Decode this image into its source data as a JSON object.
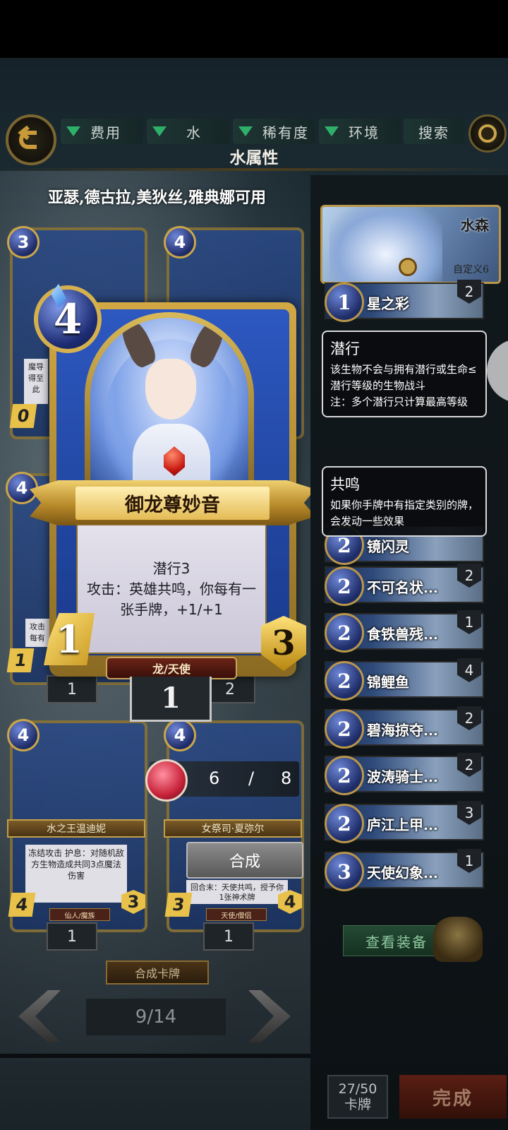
{
  "filters": [
    {
      "label": "费用"
    },
    {
      "label": "水"
    },
    {
      "label": "稀有度"
    },
    {
      "label": "环境"
    }
  ],
  "search_label": "搜索",
  "section_title": "水属性",
  "usable_heroes": "亚瑟,德古拉,美狄丝,雅典娜可用",
  "background_cards": {
    "c1": {
      "cost": "3",
      "count_bottom": "0",
      "text_fragment": "魔导\n得至\n此"
    },
    "c2": {
      "cost": "4"
    },
    "c3": {
      "cost": "4",
      "count": "1",
      "atk": "1",
      "text_fragment": "攻击\n每有"
    },
    "c4": {
      "count": "2"
    },
    "c5": {
      "cost": "4",
      "name": "水之王温迪妮",
      "text": "冻结攻击\n护息：对随机敌方生物造成共同3点魔法伤害",
      "atk": "4",
      "hp": "3",
      "tribe": "仙人/魔族",
      "count": "1"
    },
    "c6": {
      "cost": "4",
      "name": "女祭司·夏弥尔",
      "text": "回合末：天使共鸣，授予你1张神术牌",
      "atk": "3",
      "hp": "4",
      "tribe": "天使/僧侣",
      "count": "1"
    }
  },
  "featured_card": {
    "cost": "4",
    "name": "御龙尊妙音",
    "description": "潜行3\n攻击：英雄共鸣，你每有一张手牌，+1/+1",
    "attack": "1",
    "health": "3",
    "tribe": "龙/天使",
    "owned_count": "1"
  },
  "crafting": {
    "dust_current": "6",
    "dust_sep": "/",
    "dust_required": "8",
    "craft_button": "合成",
    "craft_section_label": "合成卡牌",
    "page_indicator": "9/14"
  },
  "deck": {
    "name": "水森",
    "custom_label": "自定义6",
    "cards": [
      {
        "cost": "1",
        "name": "星之彩",
        "count": "2"
      },
      {
        "cost": "2",
        "name": "镜闪灵",
        "count": ""
      },
      {
        "cost": "2",
        "name": "不可名状...",
        "count": "2"
      },
      {
        "cost": "2",
        "name": "食铁兽残...",
        "count": "1"
      },
      {
        "cost": "2",
        "name": "锦鲤鱼",
        "count": "4"
      },
      {
        "cost": "2",
        "name": "碧海掠夺...",
        "count": "2"
      },
      {
        "cost": "2",
        "name": "波涛骑士...",
        "count": "2"
      },
      {
        "cost": "2",
        "name": "庐江上甲...",
        "count": "3"
      },
      {
        "cost": "3",
        "name": "天使幻象...",
        "count": "1"
      }
    ],
    "view_equipment": "查看装备",
    "card_count_value": "27/50",
    "card_count_label": "卡牌",
    "done_button": "完成"
  },
  "tooltips": [
    {
      "title": "潜行",
      "body": "该生物不会与拥有潜行或生命≤潜行等级的生物战斗\n注：多个潜行只计算最高等级"
    },
    {
      "title": "共鸣",
      "body": "如果你手牌中有指定类别的牌，会发动一些效果"
    }
  ]
}
